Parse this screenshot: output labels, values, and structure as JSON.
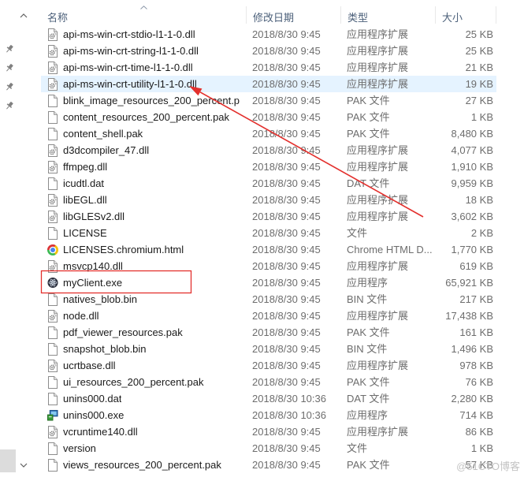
{
  "colors": {
    "name_text": "#1a1a1a",
    "detail_text": "#6d6d6d",
    "header_text": "#4c607a",
    "hover_row_bg": "#e5f3ff",
    "annotation_red": "#e3302d",
    "watermark": "#bdbdbd"
  },
  "nav_pane": {
    "pinned_icons": [
      "pin-icon",
      "pin-icon",
      "pin-icon",
      "pin-icon"
    ],
    "scroll_up_icon": "chevron-up-icon",
    "scroll_down_icon": "chevron-down-icon"
  },
  "columns": [
    {
      "label": "名称",
      "sort_icon": "chevron-up-icon"
    },
    {
      "label": "修改日期"
    },
    {
      "label": "类型"
    },
    {
      "label": "大小"
    }
  ],
  "files": [
    {
      "name": "api-ms-win-crt-stdio-l1-1-0.dll",
      "modified": "2018/8/30 9:45",
      "type": "应用程序扩展",
      "size": "25 KB",
      "icon": "dll-gear-document-icon"
    },
    {
      "name": "api-ms-win-crt-string-l1-1-0.dll",
      "modified": "2018/8/30 9:45",
      "type": "应用程序扩展",
      "size": "25 KB",
      "icon": "dll-gear-document-icon"
    },
    {
      "name": "api-ms-win-crt-time-l1-1-0.dll",
      "modified": "2018/8/30 9:45",
      "type": "应用程序扩展",
      "size": "21 KB",
      "icon": "dll-gear-document-icon"
    },
    {
      "name": "api-ms-win-crt-utility-l1-1-0.dll",
      "modified": "2018/8/30 9:45",
      "type": "应用程序扩展",
      "size": "19 KB",
      "icon": "dll-gear-document-icon",
      "highlighted": true,
      "arrow_target": true
    },
    {
      "name": "blink_image_resources_200_percent.p",
      "modified": "2018/8/30 9:45",
      "type": "PAK 文件",
      "size": "27 KB",
      "icon": "blank-document-icon"
    },
    {
      "name": "content_resources_200_percent.pak",
      "modified": "2018/8/30 9:45",
      "type": "PAK 文件",
      "size": "1 KB",
      "icon": "blank-document-icon"
    },
    {
      "name": "content_shell.pak",
      "modified": "2018/8/30 9:45",
      "type": "PAK 文件",
      "size": "8,480 KB",
      "icon": "blank-document-icon"
    },
    {
      "name": "d3dcompiler_47.dll",
      "modified": "2018/8/30 9:45",
      "type": "应用程序扩展",
      "size": "4,077 KB",
      "icon": "dll-gear-document-icon"
    },
    {
      "name": "ffmpeg.dll",
      "modified": "2018/8/30 9:45",
      "type": "应用程序扩展",
      "size": "1,910 KB",
      "icon": "dll-gear-document-icon"
    },
    {
      "name": "icudtl.dat",
      "modified": "2018/8/30 9:45",
      "type": "DAT 文件",
      "size": "9,959 KB",
      "icon": "blank-document-icon"
    },
    {
      "name": "libEGL.dll",
      "modified": "2018/8/30 9:45",
      "type": "应用程序扩展",
      "size": "18 KB",
      "icon": "dll-gear-document-icon"
    },
    {
      "name": "libGLESv2.dll",
      "modified": "2018/8/30 9:45",
      "type": "应用程序扩展",
      "size": "3,602 KB",
      "icon": "dll-gear-document-icon"
    },
    {
      "name": "LICENSE",
      "modified": "2018/8/30 9:45",
      "type": "文件",
      "size": "2 KB",
      "icon": "blank-document-icon"
    },
    {
      "name": "LICENSES.chromium.html",
      "modified": "2018/8/30 9:45",
      "type": "Chrome HTML D...",
      "size": "1,770 KB",
      "icon": "chrome-browser-icon"
    },
    {
      "name": "msvcp140.dll",
      "modified": "2018/8/30 9:45",
      "type": "应用程序扩展",
      "size": "619 KB",
      "icon": "dll-gear-document-icon"
    },
    {
      "name": "myClient.exe",
      "modified": "2018/8/30 9:45",
      "type": "应用程序",
      "size": "65,921 KB",
      "icon": "atom-app-icon",
      "boxed": true
    },
    {
      "name": "natives_blob.bin",
      "modified": "2018/8/30 9:45",
      "type": "BIN 文件",
      "size": "217 KB",
      "icon": "blank-document-icon"
    },
    {
      "name": "node.dll",
      "modified": "2018/8/30 9:45",
      "type": "应用程序扩展",
      "size": "17,438 KB",
      "icon": "dll-gear-document-icon"
    },
    {
      "name": "pdf_viewer_resources.pak",
      "modified": "2018/8/30 9:45",
      "type": "PAK 文件",
      "size": "161 KB",
      "icon": "blank-document-icon"
    },
    {
      "name": "snapshot_blob.bin",
      "modified": "2018/8/30 9:45",
      "type": "BIN 文件",
      "size": "1,496 KB",
      "icon": "blank-document-icon"
    },
    {
      "name": "ucrtbase.dll",
      "modified": "2018/8/30 9:45",
      "type": "应用程序扩展",
      "size": "978 KB",
      "icon": "dll-gear-document-icon"
    },
    {
      "name": "ui_resources_200_percent.pak",
      "modified": "2018/8/30 9:45",
      "type": "PAK 文件",
      "size": "76 KB",
      "icon": "blank-document-icon"
    },
    {
      "name": "unins000.dat",
      "modified": "2018/8/30 10:36",
      "type": "DAT 文件",
      "size": "2,280 KB",
      "icon": "blank-document-icon"
    },
    {
      "name": "unins000.exe",
      "modified": "2018/8/30 10:36",
      "type": "应用程序",
      "size": "714 KB",
      "icon": "installer-package-icon"
    },
    {
      "name": "vcruntime140.dll",
      "modified": "2018/8/30 9:45",
      "type": "应用程序扩展",
      "size": "86 KB",
      "icon": "dll-gear-document-icon"
    },
    {
      "name": "version",
      "modified": "2018/8/30 9:45",
      "type": "文件",
      "size": "1 KB",
      "icon": "blank-document-icon"
    },
    {
      "name": "views_resources_200_percent.pak",
      "modified": "2018/8/30 9:45",
      "type": "PAK 文件",
      "size": "57 KB",
      "icon": "blank-document-icon"
    }
  ],
  "watermark": "@51CTO博客"
}
